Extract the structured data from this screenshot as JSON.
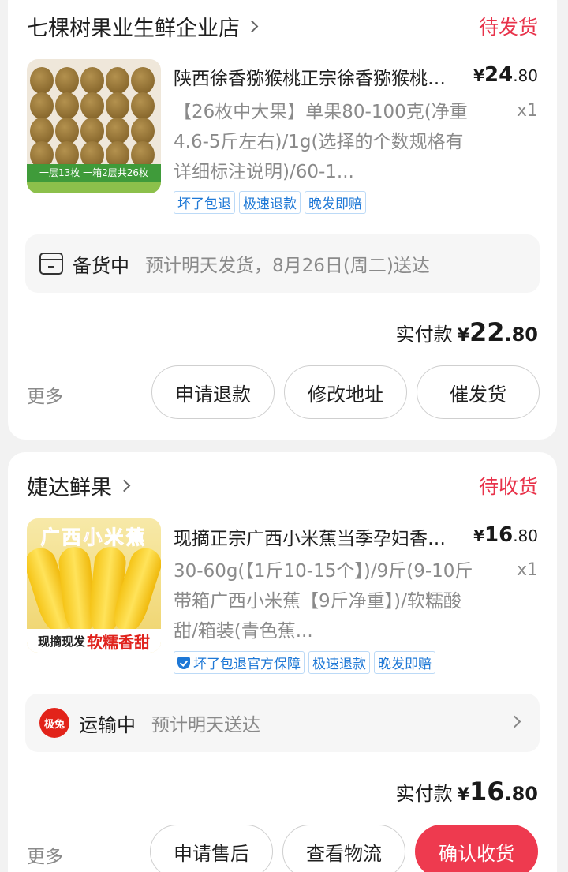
{
  "orders": [
    {
      "store_name": "七棵树果业生鲜企业店",
      "status": "待发货",
      "product_name": "陕西徐香猕猴桃正宗徐香猕猴桃新鲜水果",
      "price_symbol": "¥",
      "price_int": "24",
      "price_dec": ".80",
      "spec": "【26枚中大果】单果80-100克(净重4.6-5斤左右)/1g(选择的个数规格有详细标注说明)/60-1...",
      "qty": "x1",
      "tags": [
        "坏了包退",
        "极速退款",
        "晚发即赔"
      ],
      "thumb_band": "一层13枚 一箱2层共26枚",
      "shipping_state": "备货中",
      "shipping_desc": "预计明天发货，8月26日(周二)送达",
      "paid_label": "实付款",
      "paid_symbol": "¥",
      "paid_int": "22",
      "paid_dec": ".80",
      "more": "更多",
      "buttons": [
        "申请退款",
        "修改地址",
        "催发货"
      ]
    },
    {
      "store_name": "婕达鲜果",
      "status": "待收货",
      "product_name": "现摘正宗广西小米蕉当季孕妇香蕉新鲜水果",
      "price_symbol": "¥",
      "price_int": "16",
      "price_dec": ".80",
      "spec": "30-60g(【1斤10-15个】)/9斤(9-10斤带箱广西小米蕉【9斤净重】)/软糯酸甜/箱装(青色蕉...",
      "qty": "x1",
      "tags": [
        "坏了包退官方保障",
        "极速退款",
        "晚发即赔"
      ],
      "thumb_top": "广西小米蕉",
      "thumb_bottom_a": "现摘现发",
      "thumb_bottom_b": "软糯香甜",
      "courier_icon": "极兔",
      "shipping_state": "运输中",
      "shipping_desc": "预计明天送达",
      "paid_label": "实付款",
      "paid_symbol": "¥",
      "paid_int": "16",
      "paid_dec": ".80",
      "more": "更多",
      "buttons": [
        "申请售后",
        "查看物流",
        "确认收货"
      ]
    }
  ],
  "colors": {
    "accent": "#e8324a",
    "primary_button": "#ee3a4f",
    "tag_blue": "#1e78d6",
    "muted_text": "#8a8a8a"
  },
  "icons": {
    "store_chevron": "chevron-right-icon",
    "box": "package-box-icon",
    "courier": "jitu-courier-icon",
    "shield": "shield-check-icon"
  }
}
